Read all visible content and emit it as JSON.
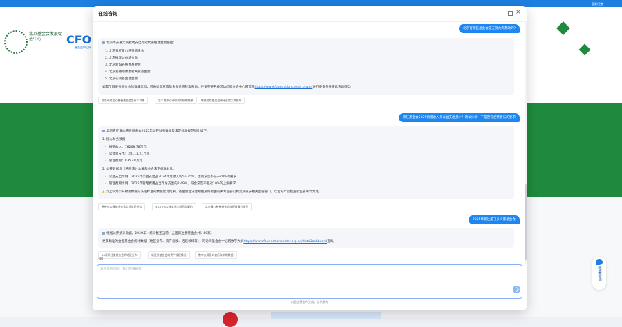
{
  "page": {
    "topbar_text": "登录/注册",
    "logo_text": "北京基金会发展促进中心",
    "cfo_text": "CFO",
    "cfo_sub": "基金会中心网"
  },
  "side_help": {
    "label": "我要咨询",
    "icon": "chat-icon"
  },
  "dialog": {
    "title": "在线咨询",
    "maximize_icon": "maximize-icon",
    "close_label": "×"
  },
  "conversation": [
    {
      "question": "北京有哪些基金会是支持大病救助的?",
      "answer": {
        "lines": [
          "北京市开展大病救助支出有效代表性基金会包括：",
          "1. 北京青红爱心慈善基金会",
          "2. 北京微爱公益基金会",
          "3. 北京新阳光慈善基金会",
          "4. 北京爱德助康患者关爱基金会",
          "5. 北京心润基金基金会",
          "如需了解更多基金会的详细信息，可通过北京市基金会名称检索查询，更多完整名录可访问基金会中心网官网"
        ],
        "link": "https://www.foundationcenter.org.cn",
        "link_suffix": "进行更多条件筛选查询哦😊",
        "suggestions": [
          "北京青红爱心慈善基金会是什么背景",
          "怎么查中心网收到的捐赠结果",
          "哪些北京基金会承接医院大病救助"
        ]
      }
    },
    {
      "question": "青红基金会2025捐赠收入和公益支出多少？请以分析一下是否符合慈善法的要求",
      "answer": {
        "lines": [
          "北京青红爱心慈善基金会2025年公开财务数据及法定标准规范对比如下：",
          "1. 核心财务数据：",
          "捐赠收入：78268.78万元",
          "公益总支出：28111.21万元",
          "管理费用：835.48万元",
          "2. 公开数据与《慈善法》公募基金会法定标准对比：",
          "公益支出比例：2025年公益支出占2024年总收入的55.75%，达到法定不低于70%的要求",
          "管理费用比例：2025年管理费用占当年总支出的2.49%，符合法定不超过10%的上限要求",
          "以上仅为公开财务数据与法定标准的数据比对结果，基金会合法合规性最终需由有关专业部门判定或属于相关监管部门，以官方年度检查及监管审计为准。"
        ],
        "suggestions": [
          "慈善法公募基金会法定标准是什么",
          "55.75%公益支出比例怎么算的",
          "北京青红慈善基金会年报披露在哪里"
        ]
      }
    },
    {
      "question": "2025年新注册了多少家基金会",
      "answer": {
        "lines": [
          "根据公开统计数据，2026年（统计截至当前）全国新注册基金会共计86家。",
          "更多精准的全国基金会统计数据（地区分布、资产规模、活跃领域等），可访问基金会中心网数字大屏"
        ],
        "link": "https://www.foundationcenter.org.cn/dataDashboard",
        "link_suffix": "查询。",
        "suggestions": [
          "86家新注册基金会的地区分布",
          "新注册基金会的资产规模情况",
          "数字大屏怎么查历年新增数据"
        ]
      }
    }
  ],
  "input": {
    "placeholder": "请将您的问题，我们尽快解答",
    "clear_icon": "clear-icon",
    "send_icon": "send-icon"
  },
  "footer_note": "内容由基金AI生成，仅供参考"
}
